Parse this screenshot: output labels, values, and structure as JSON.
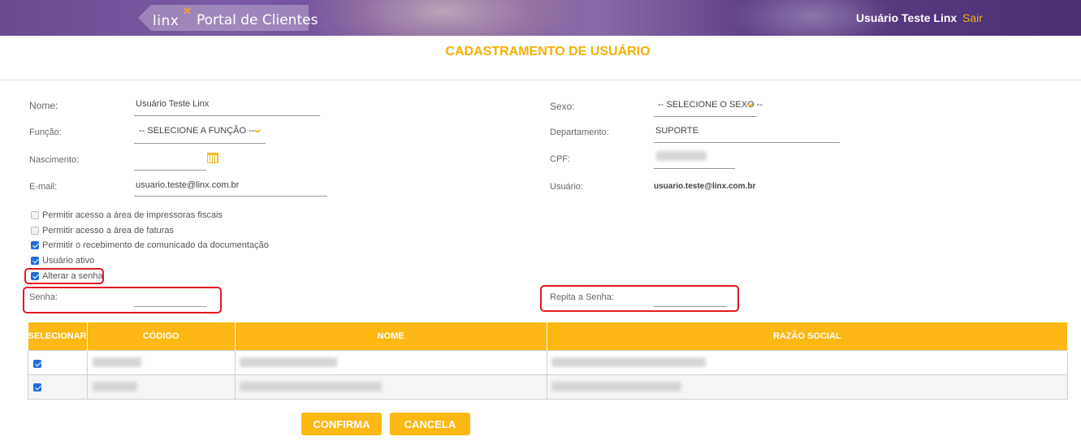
{
  "header": {
    "logo_brand": "linx",
    "logo_text": "Portal de Clientes",
    "user_name": "Usuário Teste Linx",
    "logout_label": "Sair"
  },
  "page_title": "CADASTRAMENTO DE USUÁRIO",
  "form": {
    "nome": {
      "label": "Nome:",
      "value": "Usuário Teste Linx"
    },
    "funcao": {
      "label": "Função:",
      "value": "-- SELECIONE A FUNÇÃO --"
    },
    "nascimento": {
      "label": "Nascimento:",
      "value": ""
    },
    "email": {
      "label": "E-mail:",
      "value": "usuario.teste@linx.com.br"
    },
    "sexo": {
      "label": "Sexo:",
      "value": "-- SELECIONE O SEXO --"
    },
    "departamento": {
      "label": "Departamento:",
      "value": "SUPORTE"
    },
    "cpf": {
      "label": "CPF:",
      "value": ""
    },
    "usuario": {
      "label": "Usuário:",
      "value": "usuario.teste@linx.com.br"
    },
    "senha": {
      "label": "Senha:",
      "value": ""
    },
    "repita_senha": {
      "label": "Repita a Senha:",
      "value": ""
    }
  },
  "checkboxes": [
    {
      "label": "Permitir acesso a área de impressoras fiscais",
      "checked": false
    },
    {
      "label": "Permitir acesso a área de faturas",
      "checked": false
    },
    {
      "label": "Permitir o recebimento de comunicado da documentação",
      "checked": true
    },
    {
      "label": "Usuário ativo",
      "checked": true
    },
    {
      "label": "Alterar a senha",
      "checked": true
    }
  ],
  "table": {
    "columns": [
      "SELECIONAR",
      "CÓDIGO",
      "NOME",
      "RAZÃO SOCIAL"
    ],
    "rows": [
      {
        "selected": true
      },
      {
        "selected": true
      }
    ]
  },
  "buttons": {
    "confirm": "CONFIRMA",
    "cancel": "CANCELA"
  },
  "colors": {
    "accent": "#fdb813",
    "highlight": "#e01b24",
    "checkbox": "#1e6fd9",
    "banner": "#6a4a8f"
  }
}
